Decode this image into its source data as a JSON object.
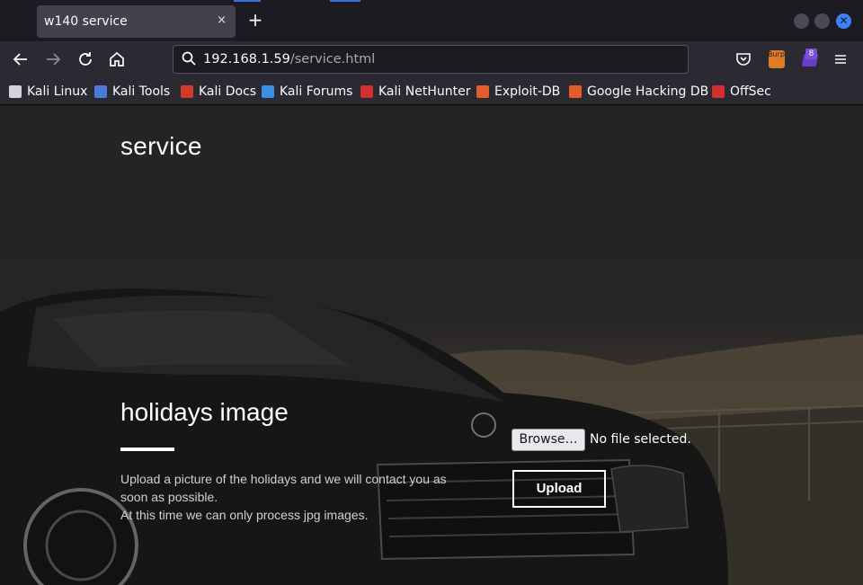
{
  "browser": {
    "tab": {
      "title": "w140 service",
      "close_glyph": "×"
    },
    "new_tab_glyph": "+",
    "url": {
      "host": "192.168.1.59",
      "path": "/service.html"
    },
    "toolbar_icons": [
      "pocket-icon",
      "burp-extension-icon",
      "extension-badge-icon",
      "menu-icon"
    ],
    "extension_badge": "8",
    "burp_label": "Burp"
  },
  "bookmarks": [
    {
      "label": "Kali Linux",
      "icon": "kali-dragon-icon",
      "color": "#cfd4de"
    },
    {
      "label": "Kali Tools",
      "icon": "kali-tools-icon",
      "color": "#4a7bd8"
    },
    {
      "label": "Kali Docs",
      "icon": "kali-docs-icon",
      "color": "#d33a2c"
    },
    {
      "label": "Kali Forums",
      "icon": "kali-forums-icon",
      "color": "#3a8ee6"
    },
    {
      "label": "Kali NetHunter",
      "icon": "nethunter-icon",
      "color": "#d32f2f"
    },
    {
      "label": "Exploit-DB",
      "icon": "exploit-db-icon",
      "color": "#e35d2c"
    },
    {
      "label": "Google Hacking DB",
      "icon": "ghdb-icon",
      "color": "#e35d2c"
    },
    {
      "label": "OffSec",
      "icon": "offsec-icon",
      "color": "#d32f2f"
    }
  ],
  "page": {
    "site_title": "service",
    "section_title": "holidays image",
    "description_lines": [
      "Upload a picture of the holidays and we will contact you as",
      "soon as possible.",
      "At this time we can only process jpg images."
    ],
    "browse_label": "Browse…",
    "file_status": "No file selected.",
    "upload_label": "Upload"
  }
}
